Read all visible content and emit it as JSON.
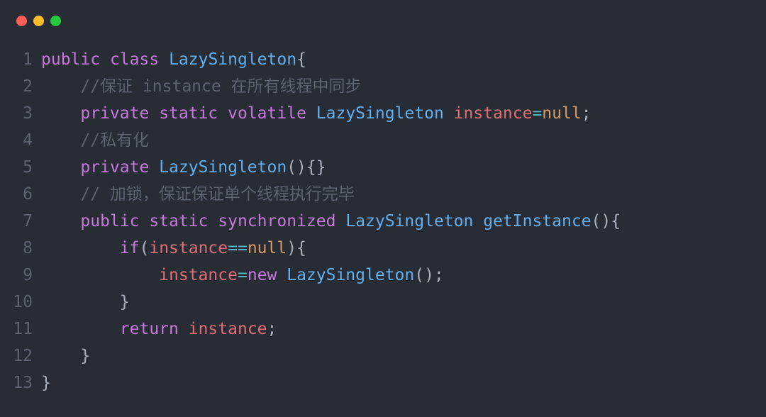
{
  "window": {
    "controls": [
      "close",
      "minimize",
      "zoom"
    ]
  },
  "code": {
    "lines": [
      {
        "n": "1",
        "tokens": [
          {
            "c": "kw",
            "t": "public"
          },
          {
            "c": "",
            "t": " "
          },
          {
            "c": "kw",
            "t": "class"
          },
          {
            "c": "",
            "t": " "
          },
          {
            "c": "cls",
            "t": "LazySingleton"
          },
          {
            "c": "punct",
            "t": "{"
          }
        ]
      },
      {
        "n": "2",
        "tokens": [
          {
            "c": "",
            "t": "    "
          },
          {
            "c": "comment",
            "t": "//保证 instance 在所有线程中同步"
          }
        ]
      },
      {
        "n": "3",
        "tokens": [
          {
            "c": "",
            "t": "    "
          },
          {
            "c": "kw",
            "t": "private"
          },
          {
            "c": "",
            "t": " "
          },
          {
            "c": "kw",
            "t": "static"
          },
          {
            "c": "",
            "t": " "
          },
          {
            "c": "kw",
            "t": "volatile"
          },
          {
            "c": "",
            "t": " "
          },
          {
            "c": "cls",
            "t": "LazySingleton"
          },
          {
            "c": "",
            "t": " "
          },
          {
            "c": "prop",
            "t": "instance"
          },
          {
            "c": "op",
            "t": "="
          },
          {
            "c": "const",
            "t": "null"
          },
          {
            "c": "punct",
            "t": ";"
          }
        ]
      },
      {
        "n": "4",
        "tokens": [
          {
            "c": "",
            "t": "    "
          },
          {
            "c": "comment",
            "t": "//私有化"
          }
        ]
      },
      {
        "n": "5",
        "tokens": [
          {
            "c": "",
            "t": "    "
          },
          {
            "c": "kw",
            "t": "private"
          },
          {
            "c": "",
            "t": " "
          },
          {
            "c": "cls",
            "t": "LazySingleton"
          },
          {
            "c": "punct",
            "t": "(){}"
          }
        ]
      },
      {
        "n": "6",
        "tokens": [
          {
            "c": "",
            "t": "    "
          },
          {
            "c": "comment",
            "t": "// 加锁，保证保证单个线程执行完毕"
          }
        ]
      },
      {
        "n": "7",
        "tokens": [
          {
            "c": "",
            "t": "    "
          },
          {
            "c": "kw",
            "t": "public"
          },
          {
            "c": "",
            "t": " "
          },
          {
            "c": "kw",
            "t": "static"
          },
          {
            "c": "",
            "t": " "
          },
          {
            "c": "kw",
            "t": "synchronized"
          },
          {
            "c": "",
            "t": " "
          },
          {
            "c": "cls",
            "t": "LazySingleton"
          },
          {
            "c": "",
            "t": " "
          },
          {
            "c": "fn",
            "t": "getInstance"
          },
          {
            "c": "punct",
            "t": "(){"
          }
        ]
      },
      {
        "n": "8",
        "tokens": [
          {
            "c": "",
            "t": "        "
          },
          {
            "c": "kw",
            "t": "if"
          },
          {
            "c": "punct",
            "t": "("
          },
          {
            "c": "prop",
            "t": "instance"
          },
          {
            "c": "op",
            "t": "=="
          },
          {
            "c": "const",
            "t": "null"
          },
          {
            "c": "punct",
            "t": "){"
          }
        ]
      },
      {
        "n": "9",
        "tokens": [
          {
            "c": "",
            "t": "            "
          },
          {
            "c": "prop",
            "t": "instance"
          },
          {
            "c": "op",
            "t": "="
          },
          {
            "c": "kw",
            "t": "new"
          },
          {
            "c": "",
            "t": " "
          },
          {
            "c": "cls",
            "t": "LazySingleton"
          },
          {
            "c": "punct",
            "t": "();"
          }
        ]
      },
      {
        "n": "10",
        "tokens": [
          {
            "c": "",
            "t": "        "
          },
          {
            "c": "punct",
            "t": "}"
          }
        ]
      },
      {
        "n": "11",
        "tokens": [
          {
            "c": "",
            "t": "        "
          },
          {
            "c": "kw",
            "t": "return"
          },
          {
            "c": "",
            "t": " "
          },
          {
            "c": "prop",
            "t": "instance"
          },
          {
            "c": "punct",
            "t": ";"
          }
        ]
      },
      {
        "n": "12",
        "tokens": [
          {
            "c": "",
            "t": "    "
          },
          {
            "c": "punct",
            "t": "}"
          }
        ]
      },
      {
        "n": "13",
        "tokens": [
          {
            "c": "punct",
            "t": "}"
          }
        ]
      }
    ]
  }
}
